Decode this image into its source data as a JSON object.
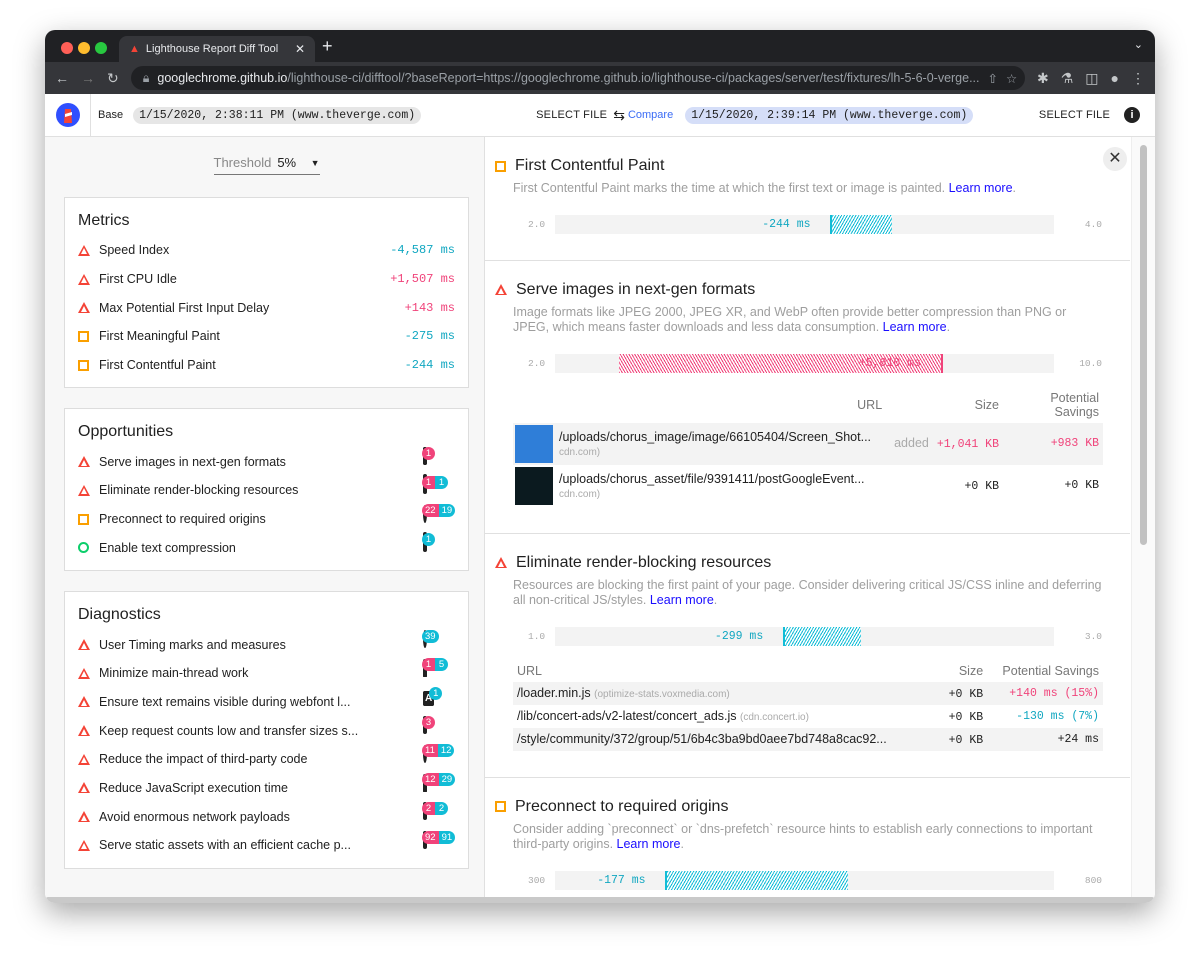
{
  "browser": {
    "tab_title": "Lighthouse Report Diff Tool",
    "url_host": "googlechrome.github.io",
    "url_path": "/lighthouse-ci/difftool/?baseReport=https://googlechrome.github.io/lighthouse-ci/packages/server/test/fixtures/lh-5-6-0-verge..."
  },
  "header": {
    "base_label": "Base",
    "base_report": "1/15/2020, 2:38:11 PM (www.theverge.com)",
    "select_file": "SELECT FILE",
    "compare_label": "Compare",
    "compare_report": "1/15/2020, 2:39:14 PM (www.theverge.com)"
  },
  "threshold": {
    "label": "Threshold",
    "value": "5%"
  },
  "metrics": {
    "title": "Metrics",
    "items": [
      {
        "status": "fail",
        "label": "Speed Index",
        "delta": "-4,587 ms",
        "dir": "neg"
      },
      {
        "status": "fail",
        "label": "First CPU Idle",
        "delta": "+1,507 ms",
        "dir": "pos"
      },
      {
        "status": "fail",
        "label": "Max Potential First Input Delay",
        "delta": "+143 ms",
        "dir": "pos"
      },
      {
        "status": "average",
        "label": "First Meaningful Paint",
        "delta": "-275 ms",
        "dir": "neg"
      },
      {
        "status": "average",
        "label": "First Contentful Paint",
        "delta": "-244 ms",
        "dir": "neg"
      }
    ]
  },
  "opportunities": {
    "title": "Opportunities",
    "items": [
      {
        "status": "fail",
        "label": "Serve images in next-gen formats",
        "icon": "image-icon",
        "added": "1",
        "removed": ""
      },
      {
        "status": "fail",
        "label": "Eliminate render-blocking resources",
        "icon": "window-icon",
        "added": "1",
        "removed": "1"
      },
      {
        "status": "average",
        "label": "Preconnect to required origins",
        "icon": "globe-icon",
        "added": "22",
        "removed": "19"
      },
      {
        "status": "pass",
        "label": "Enable text compression",
        "icon": "window-icon",
        "added": "",
        "removed": "1"
      }
    ]
  },
  "diagnostics": {
    "title": "Diagnostics",
    "items": [
      {
        "status": "fail",
        "label": "User Timing marks and measures",
        "icon": "timer-icon",
        "added": "",
        "removed": "39"
      },
      {
        "status": "fail",
        "label": "Minimize main-thread work",
        "icon": "gauge-icon",
        "added": "1",
        "removed": "5"
      },
      {
        "status": "fail",
        "label": "Ensure text remains visible during webfont l...",
        "icon": "font-icon",
        "added": "",
        "removed": "1"
      },
      {
        "status": "fail",
        "label": "Keep request counts low and transfer sizes s...",
        "icon": "list-icon",
        "added": "3",
        "removed": ""
      },
      {
        "status": "fail",
        "label": "Reduce the impact of third-party code",
        "icon": "globe-icon",
        "added": "11",
        "removed": "12"
      },
      {
        "status": "fail",
        "label": "Reduce JavaScript execution time",
        "icon": "gauge-icon",
        "added": "12",
        "removed": "29"
      },
      {
        "status": "fail",
        "label": "Avoid enormous network payloads",
        "icon": "list-icon",
        "added": "2",
        "removed": "2"
      },
      {
        "status": "fail",
        "label": "Serve static assets with an efficient cache p...",
        "icon": "list-icon",
        "added": "92",
        "removed": "91"
      }
    ]
  },
  "details": [
    {
      "status": "average",
      "title": "First Contentful Paint",
      "desc": "First Contentful Paint marks the time at which the first text or image is painted.",
      "learn_more": "Learn more",
      "range_min": "2.0",
      "range_max": "4.0",
      "min": 2,
      "max": 4,
      "base": 3.31,
      "compare": 3.07,
      "delta": "-244 ms",
      "dir": "neg"
    },
    {
      "status": "fail",
      "title": "Serve images in next-gen formats",
      "desc": "Image formats like JPEG 2000, JPEG XR, and WebP often provide better compression than PNG or JPEG, which means faster downloads and less data consumption.",
      "learn_more": "Learn more",
      "range_min": "2.0",
      "range_max": "10.0",
      "min": 2,
      "max": 10,
      "base": 2.99,
      "compare": 8.03,
      "delta": "+5,010 ms",
      "dir": "pos",
      "table": {
        "headers": [
          "URL",
          "Size",
          "Potential Savings"
        ],
        "rows": [
          {
            "url": "/uploads/chorus_image/image/66105404/Screen_Shot...",
            "host": "cdn.com)",
            "tag": "added",
            "size": "+1,041 KB",
            "size_dir": "pos",
            "savings": "+983 KB",
            "savings_dir": "pos",
            "thumb": "#2f7ed8"
          },
          {
            "url": "/uploads/chorus_asset/file/9391411/postGoogleEvent...",
            "host": "cdn.com)",
            "tag": "",
            "size": "+0 KB",
            "size_dir": "",
            "savings": "+0 KB",
            "savings_dir": "",
            "thumb": "#0b1a1f"
          }
        ]
      }
    },
    {
      "status": "fail",
      "title": "Eliminate render-blocking resources",
      "desc": "Resources are blocking the first paint of your page. Consider delivering critical JS/CSS inline and deferring all non-critical JS/styles.",
      "learn_more": "Learn more",
      "range_min": "1.0",
      "range_max": "3.0",
      "min": 1,
      "max": 3,
      "base": 2.19,
      "compare": 1.886,
      "delta": "-299 ms",
      "dir": "neg",
      "table": {
        "headers": [
          "URL",
          "Size",
          "Potential Savings"
        ],
        "rows": [
          {
            "url": "/loader.min.js",
            "host": "(optimize-stats.voxmedia.com)",
            "tag": "",
            "size": "+0 KB",
            "size_dir": "",
            "savings": "+140 ms (15%)",
            "savings_dir": "pos"
          },
          {
            "url": "/lib/concert-ads/v2-latest/concert_ads.js",
            "host": "(cdn.concert.io)",
            "tag": "",
            "size": "+0 KB",
            "size_dir": "",
            "savings": "-130 ms (7%)",
            "savings_dir": "neg"
          },
          {
            "url": "/style/community/372/group/51/6b4c3ba9bd0aee7bd748a8cac92...",
            "host": "",
            "tag": "",
            "size": "+0 KB",
            "size_dir": "",
            "savings": "+24 ms",
            "savings_dir": ""
          }
        ]
      }
    },
    {
      "status": "average",
      "title": "Preconnect to required origins",
      "desc": "Consider adding `preconnect` or `dns-prefetch` resource hints to establish early connections to important third-party origins.",
      "learn_more": "Learn more",
      "range_min": "300",
      "range_max": "800",
      "min": 300,
      "max": 800,
      "base": 585,
      "compare": 407,
      "delta": "-177 ms",
      "dir": "neg"
    }
  ],
  "colors": {
    "improvement": "#11bcd6",
    "regression": "#f0437a",
    "fail": "#f44336",
    "average": "#fa9f00",
    "pass": "#0cce6b",
    "link": "#1a0dff"
  }
}
